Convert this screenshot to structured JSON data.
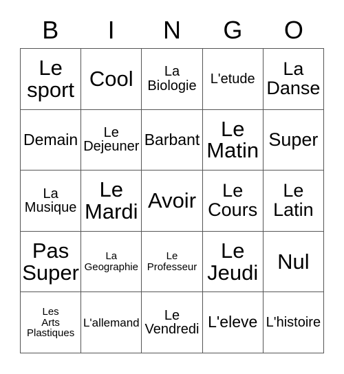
{
  "card": {
    "title": "BINGO",
    "header_letters": [
      "B",
      "I",
      "N",
      "G",
      "O"
    ],
    "rows": 5,
    "columns": 5,
    "grid_line_color": "#555555",
    "text_color": "#000000",
    "background_color": "#ffffff",
    "cells": [
      {
        "text": "Le\nsport",
        "size": "fs-xxl"
      },
      {
        "text": "Cool",
        "size": "fs-xxl"
      },
      {
        "text": "La\nBiologie",
        "size": "fs-md"
      },
      {
        "text": "L'etude",
        "size": "fs-md"
      },
      {
        "text": "La\nDanse",
        "size": "fs-xl"
      },
      {
        "text": "Demain",
        "size": "fs-lg"
      },
      {
        "text": "Le\nDejeuner",
        "size": "fs-md"
      },
      {
        "text": "Barbant",
        "size": "fs-lg"
      },
      {
        "text": "Le\nMatin",
        "size": "fs-xxl"
      },
      {
        "text": "Super",
        "size": "fs-xl"
      },
      {
        "text": "La\nMusique",
        "size": "fs-md"
      },
      {
        "text": "Le\nMardi",
        "size": "fs-xxl"
      },
      {
        "text": "Avoir",
        "size": "fs-xxl"
      },
      {
        "text": "Le\nCours",
        "size": "fs-xl"
      },
      {
        "text": "Le\nLatin",
        "size": "fs-xl"
      },
      {
        "text": "Pas\nSuper",
        "size": "fs-xxl"
      },
      {
        "text": "La\nGeographie",
        "size": "fs-xs"
      },
      {
        "text": "Le\nProfesseur",
        "size": "fs-xs"
      },
      {
        "text": "Le\nJeudi",
        "size": "fs-xxl"
      },
      {
        "text": "Nul",
        "size": "fs-xxl"
      },
      {
        "text": "Les\nArts\nPlastiques",
        "size": "fs-xs"
      },
      {
        "text": "L'allemand",
        "size": "fs-sm"
      },
      {
        "text": "Le\nVendredi",
        "size": "fs-md"
      },
      {
        "text": "L'eleve",
        "size": "fs-lg"
      },
      {
        "text": "L'histoire",
        "size": "fs-md"
      }
    ]
  }
}
